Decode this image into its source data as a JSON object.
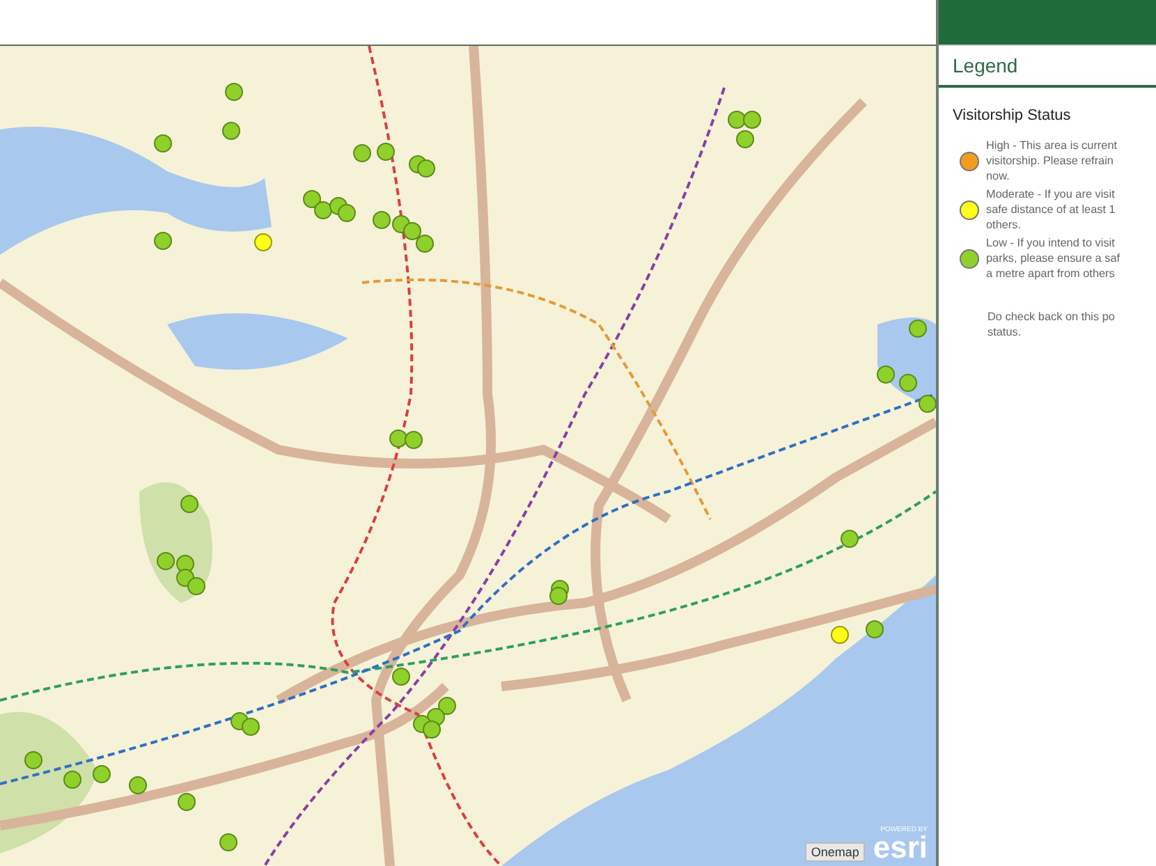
{
  "map": {
    "attribution": {
      "provider": "Onemap",
      "powered_by": "POWERED BY",
      "brand": "esri"
    }
  },
  "legend": {
    "title": "Legend",
    "section": "Visitorship Status",
    "items": [
      {
        "color": "#f39c1e",
        "text": "High - This area is current\nvisitorship. Please refrain\nnow."
      },
      {
        "color": "#ffff1a",
        "text": "Moderate - If you are visit\nsafe distance of at least 1\nothers."
      },
      {
        "color": "#8fd12a",
        "text": "Low - If you intend to visit\nparks, please ensure a saf\na metre apart from others"
      }
    ],
    "note": "Do check back on this po\nstatus."
  }
}
